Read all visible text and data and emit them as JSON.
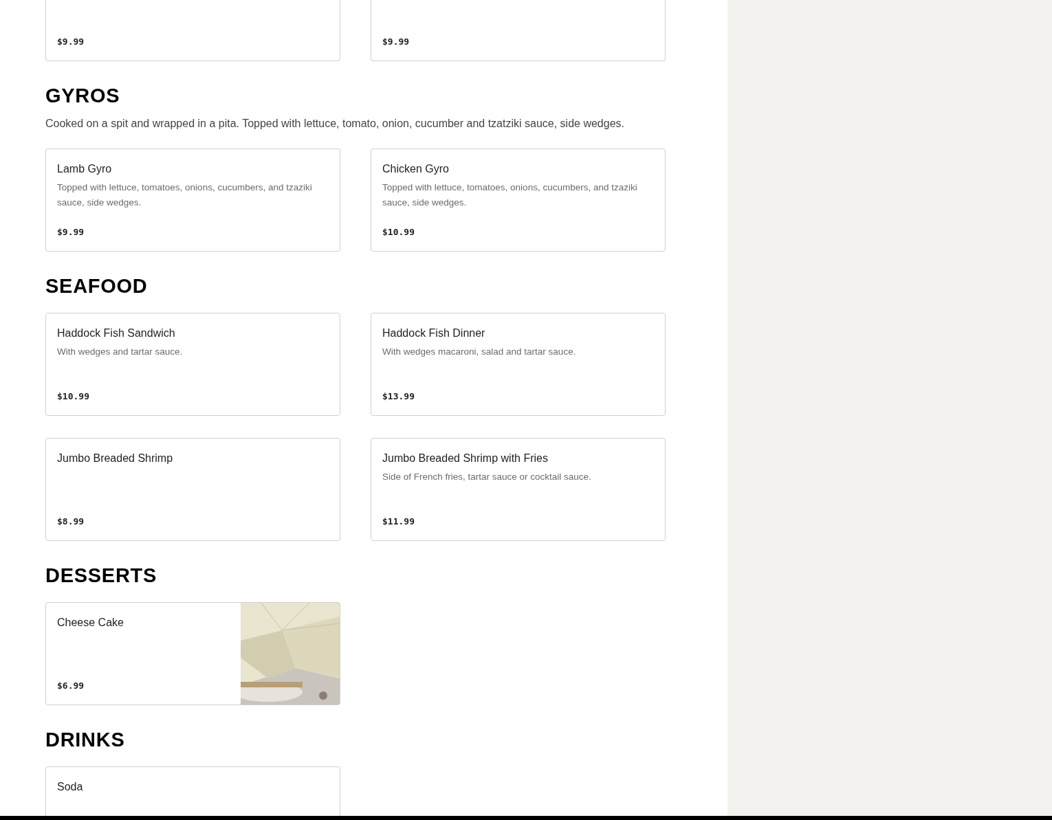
{
  "top_items": [
    {
      "price": "$9.99"
    },
    {
      "price": "$9.99"
    }
  ],
  "sections": [
    {
      "title": "GYROS",
      "description": "Cooked on a spit and wrapped in a pita. Topped with lettuce, tomato, onion, cucumber and tzatziki sauce, side wedges.",
      "items": [
        {
          "name": "Lamb Gyro",
          "description": "Topped with lettuce, tomatoes, onions, cucumbers, and tzaziki sauce, side wedges.",
          "price": "$9.99"
        },
        {
          "name": "Chicken Gyro",
          "description": "Topped with lettuce, tomatoes, onions, cucumbers, and tzaziki sauce, side wedges.",
          "price": "$10.99"
        }
      ]
    },
    {
      "title": "SEAFOOD",
      "items": [
        {
          "name": "Haddock Fish Sandwich",
          "description": "With wedges and tartar sauce.",
          "price": "$10.99"
        },
        {
          "name": "Haddock Fish Dinner",
          "description": "With wedges macaroni, salad and tartar sauce.",
          "price": "$13.99"
        },
        {
          "name": "Jumbo Breaded Shrimp",
          "price": "$8.99"
        },
        {
          "name": "Jumbo Breaded Shrimp with Fries",
          "description": "Side of French fries, tartar sauce or cocktail sauce.",
          "price": "$11.99"
        }
      ]
    },
    {
      "title": "DESSERTS",
      "items": [
        {
          "name": "Cheese Cake",
          "price": "$6.99",
          "kind": "picture"
        }
      ]
    },
    {
      "title": "DRINKS",
      "items": [
        {
          "name": "Soda"
        }
      ]
    }
  ]
}
